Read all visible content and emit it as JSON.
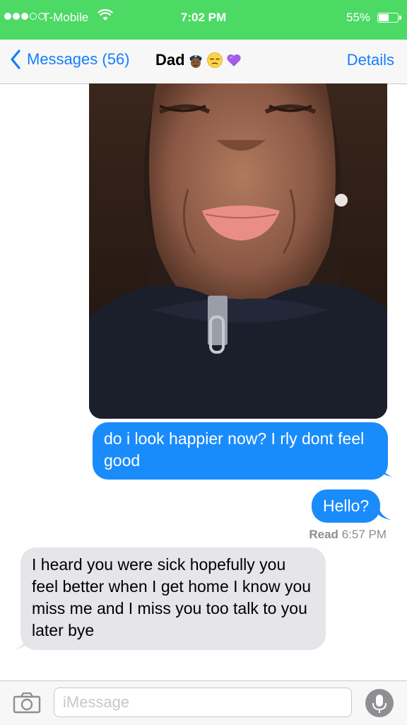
{
  "status_bar": {
    "carrier": "T-Mobile",
    "time": "7:02 PM",
    "battery_percent": "55%",
    "battery_level": 0.55,
    "signal_bars_filled": 3,
    "signal_bars_total": 5
  },
  "nav": {
    "back_label": "Messages (56)",
    "contact_name": "Dad",
    "contact_emoji": [
      "police-officer-emoji",
      "unamused-face-emoji",
      "purple-heart-emoji"
    ],
    "details_label": "Details"
  },
  "messages": [
    {
      "type": "image",
      "direction": "outgoing",
      "description_icon": "photo-attachment"
    },
    {
      "type": "text",
      "direction": "outgoing",
      "text": "do i look happier now? I rly dont feel good"
    },
    {
      "type": "text",
      "direction": "outgoing",
      "text": "Hello?"
    },
    {
      "type": "text",
      "direction": "incoming",
      "text": "I heard you were sick hopefully you feel better when I get home I know you miss me and I miss you too talk to you later bye"
    }
  ],
  "receipt": {
    "label": "Read",
    "time": "6:57 PM"
  },
  "composer": {
    "placeholder": "iMessage",
    "value": ""
  },
  "colors": {
    "status_bar": "#4cd964",
    "accent": "#147efb",
    "outgoing_bubble": "#1a8bfb",
    "incoming_bubble": "#e5e5ea"
  }
}
